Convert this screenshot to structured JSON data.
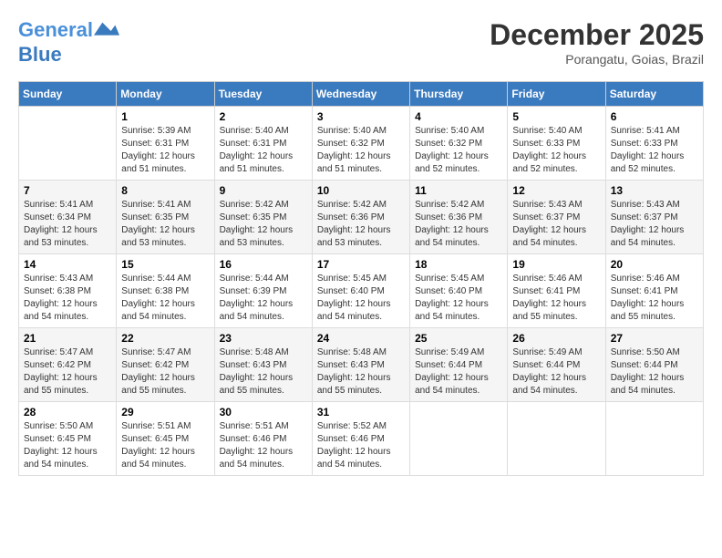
{
  "header": {
    "logo_line1": "General",
    "logo_line2": "Blue",
    "month_title": "December 2025",
    "location": "Porangatu, Goias, Brazil"
  },
  "days_of_week": [
    "Sunday",
    "Monday",
    "Tuesday",
    "Wednesday",
    "Thursday",
    "Friday",
    "Saturday"
  ],
  "weeks": [
    [
      {
        "day": "",
        "sunrise": "",
        "sunset": "",
        "daylight": ""
      },
      {
        "day": "1",
        "sunrise": "Sunrise: 5:39 AM",
        "sunset": "Sunset: 6:31 PM",
        "daylight": "Daylight: 12 hours and 51 minutes."
      },
      {
        "day": "2",
        "sunrise": "Sunrise: 5:40 AM",
        "sunset": "Sunset: 6:31 PM",
        "daylight": "Daylight: 12 hours and 51 minutes."
      },
      {
        "day": "3",
        "sunrise": "Sunrise: 5:40 AM",
        "sunset": "Sunset: 6:32 PM",
        "daylight": "Daylight: 12 hours and 51 minutes."
      },
      {
        "day": "4",
        "sunrise": "Sunrise: 5:40 AM",
        "sunset": "Sunset: 6:32 PM",
        "daylight": "Daylight: 12 hours and 52 minutes."
      },
      {
        "day": "5",
        "sunrise": "Sunrise: 5:40 AM",
        "sunset": "Sunset: 6:33 PM",
        "daylight": "Daylight: 12 hours and 52 minutes."
      },
      {
        "day": "6",
        "sunrise": "Sunrise: 5:41 AM",
        "sunset": "Sunset: 6:33 PM",
        "daylight": "Daylight: 12 hours and 52 minutes."
      }
    ],
    [
      {
        "day": "7",
        "sunrise": "Sunrise: 5:41 AM",
        "sunset": "Sunset: 6:34 PM",
        "daylight": "Daylight: 12 hours and 53 minutes."
      },
      {
        "day": "8",
        "sunrise": "Sunrise: 5:41 AM",
        "sunset": "Sunset: 6:35 PM",
        "daylight": "Daylight: 12 hours and 53 minutes."
      },
      {
        "day": "9",
        "sunrise": "Sunrise: 5:42 AM",
        "sunset": "Sunset: 6:35 PM",
        "daylight": "Daylight: 12 hours and 53 minutes."
      },
      {
        "day": "10",
        "sunrise": "Sunrise: 5:42 AM",
        "sunset": "Sunset: 6:36 PM",
        "daylight": "Daylight: 12 hours and 53 minutes."
      },
      {
        "day": "11",
        "sunrise": "Sunrise: 5:42 AM",
        "sunset": "Sunset: 6:36 PM",
        "daylight": "Daylight: 12 hours and 54 minutes."
      },
      {
        "day": "12",
        "sunrise": "Sunrise: 5:43 AM",
        "sunset": "Sunset: 6:37 PM",
        "daylight": "Daylight: 12 hours and 54 minutes."
      },
      {
        "day": "13",
        "sunrise": "Sunrise: 5:43 AM",
        "sunset": "Sunset: 6:37 PM",
        "daylight": "Daylight: 12 hours and 54 minutes."
      }
    ],
    [
      {
        "day": "14",
        "sunrise": "Sunrise: 5:43 AM",
        "sunset": "Sunset: 6:38 PM",
        "daylight": "Daylight: 12 hours and 54 minutes."
      },
      {
        "day": "15",
        "sunrise": "Sunrise: 5:44 AM",
        "sunset": "Sunset: 6:38 PM",
        "daylight": "Daylight: 12 hours and 54 minutes."
      },
      {
        "day": "16",
        "sunrise": "Sunrise: 5:44 AM",
        "sunset": "Sunset: 6:39 PM",
        "daylight": "Daylight: 12 hours and 54 minutes."
      },
      {
        "day": "17",
        "sunrise": "Sunrise: 5:45 AM",
        "sunset": "Sunset: 6:40 PM",
        "daylight": "Daylight: 12 hours and 54 minutes."
      },
      {
        "day": "18",
        "sunrise": "Sunrise: 5:45 AM",
        "sunset": "Sunset: 6:40 PM",
        "daylight": "Daylight: 12 hours and 54 minutes."
      },
      {
        "day": "19",
        "sunrise": "Sunrise: 5:46 AM",
        "sunset": "Sunset: 6:41 PM",
        "daylight": "Daylight: 12 hours and 55 minutes."
      },
      {
        "day": "20",
        "sunrise": "Sunrise: 5:46 AM",
        "sunset": "Sunset: 6:41 PM",
        "daylight": "Daylight: 12 hours and 55 minutes."
      }
    ],
    [
      {
        "day": "21",
        "sunrise": "Sunrise: 5:47 AM",
        "sunset": "Sunset: 6:42 PM",
        "daylight": "Daylight: 12 hours and 55 minutes."
      },
      {
        "day": "22",
        "sunrise": "Sunrise: 5:47 AM",
        "sunset": "Sunset: 6:42 PM",
        "daylight": "Daylight: 12 hours and 55 minutes."
      },
      {
        "day": "23",
        "sunrise": "Sunrise: 5:48 AM",
        "sunset": "Sunset: 6:43 PM",
        "daylight": "Daylight: 12 hours and 55 minutes."
      },
      {
        "day": "24",
        "sunrise": "Sunrise: 5:48 AM",
        "sunset": "Sunset: 6:43 PM",
        "daylight": "Daylight: 12 hours and 55 minutes."
      },
      {
        "day": "25",
        "sunrise": "Sunrise: 5:49 AM",
        "sunset": "Sunset: 6:44 PM",
        "daylight": "Daylight: 12 hours and 54 minutes."
      },
      {
        "day": "26",
        "sunrise": "Sunrise: 5:49 AM",
        "sunset": "Sunset: 6:44 PM",
        "daylight": "Daylight: 12 hours and 54 minutes."
      },
      {
        "day": "27",
        "sunrise": "Sunrise: 5:50 AM",
        "sunset": "Sunset: 6:44 PM",
        "daylight": "Daylight: 12 hours and 54 minutes."
      }
    ],
    [
      {
        "day": "28",
        "sunrise": "Sunrise: 5:50 AM",
        "sunset": "Sunset: 6:45 PM",
        "daylight": "Daylight: 12 hours and 54 minutes."
      },
      {
        "day": "29",
        "sunrise": "Sunrise: 5:51 AM",
        "sunset": "Sunset: 6:45 PM",
        "daylight": "Daylight: 12 hours and 54 minutes."
      },
      {
        "day": "30",
        "sunrise": "Sunrise: 5:51 AM",
        "sunset": "Sunset: 6:46 PM",
        "daylight": "Daylight: 12 hours and 54 minutes."
      },
      {
        "day": "31",
        "sunrise": "Sunrise: 5:52 AM",
        "sunset": "Sunset: 6:46 PM",
        "daylight": "Daylight: 12 hours and 54 minutes."
      },
      {
        "day": "",
        "sunrise": "",
        "sunset": "",
        "daylight": ""
      },
      {
        "day": "",
        "sunrise": "",
        "sunset": "",
        "daylight": ""
      },
      {
        "day": "",
        "sunrise": "",
        "sunset": "",
        "daylight": ""
      }
    ]
  ]
}
